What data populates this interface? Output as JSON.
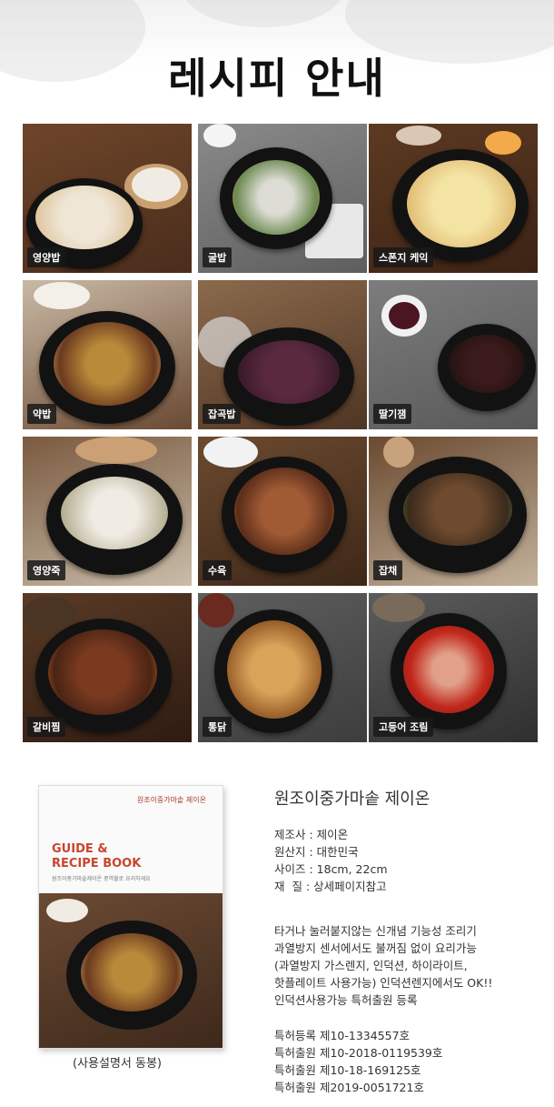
{
  "header": {
    "title": "레시피 안내"
  },
  "recipes": [
    {
      "label": "영양밥"
    },
    {
      "label": "굴밥"
    },
    {
      "label": "스폰지 케익"
    },
    {
      "label": "약밥"
    },
    {
      "label": "잡곡밥"
    },
    {
      "label": "딸기잼"
    },
    {
      "label": "영양죽"
    },
    {
      "label": "수육"
    },
    {
      "label": "잡채"
    },
    {
      "label": "갈비찜"
    },
    {
      "label": "통닭"
    },
    {
      "label": "고등어 조림"
    }
  ],
  "booklet": {
    "brand": "원조이중가마솥 제이온",
    "title_line1": "GUIDE &",
    "title_line2": "RECIPE BOOK",
    "subtitle": "원조이중가마솥제이온 중역불로 요리하세요",
    "caption": "(사용설명서 동봉)"
  },
  "product": {
    "name": "원조이중가마솥 제이온",
    "specs": [
      "제조사 : 제이온",
      "원산지 : 대한민국",
      "사이즈 : 18cm, 22cm",
      "재  질 : 상세페이지참고"
    ],
    "description": [
      "타거나 눌러붙지않는 신개념 기능성 조리기",
      "과열방지 센서에서도 불꺼짐 없이 요리가능",
      "(과열방지 가스렌지, 인덕션, 하이라이트,",
      "핫플레이트 사용가능) 인덕션렌지에서도 OK!!",
      "인덕션사용가능 특허출원 등록"
    ],
    "patents": [
      "특허등록 제10-1334557호",
      "특허출원 제10-2018-0119539호",
      "특허출원 제10-18-169125호",
      "특허출원 제2019-0051721호"
    ]
  },
  "colors": {
    "accent": "#c8452d",
    "label_bg": "#191919"
  }
}
